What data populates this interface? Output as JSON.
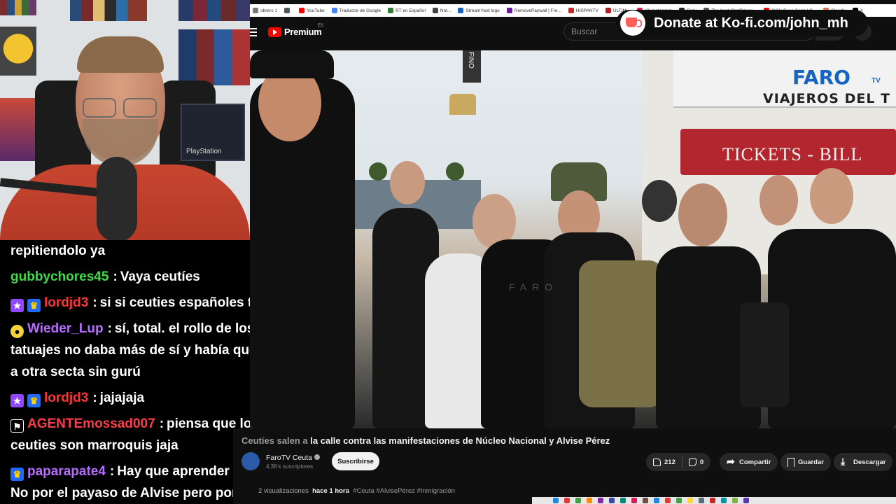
{
  "browser": {
    "bookmarks": [
      {
        "label": "obrero 1",
        "color": "#777777"
      },
      {
        "label": "",
        "color": "#555555"
      },
      {
        "label": "YouTube",
        "color": "#ff0000"
      },
      {
        "label": "Traductor de Google",
        "color": "#4285f4"
      },
      {
        "label": "RT en Español",
        "color": "#2e7d32"
      },
      {
        "label": "Not...",
        "color": "#444444"
      },
      {
        "label": "StreamYard logo",
        "color": "#1565c0"
      },
      {
        "label": "RemovePaywall | Fre...",
        "color": "#6a1b9a"
      },
      {
        "label": "HISPANTV",
        "color": "#c62828"
      },
      {
        "label": "ÚLTIM...",
        "color": "#b71c1c"
      },
      {
        "label": "(3) Instagram",
        "color": "#d81b60"
      },
      {
        "label": "Grok",
        "color": "#222222"
      },
      {
        "label": "The best ChatBot an...",
        "color": "#555555"
      },
      {
        "label": "(191) Paco Sanz / C...",
        "color": "#ff0000"
      },
      {
        "label": "Claude",
        "color": "#d97757"
      },
      {
        "label": "X",
        "color": "#000000"
      }
    ]
  },
  "youtube": {
    "logo_text": "Premium",
    "country_code": "ES",
    "search_placeholder": "Buscar",
    "video": {
      "title_dim": "Ceutíes salen a",
      "title": "la calle contra las manifestaciones de Núcleo Nacional y Alvise Pérez",
      "channel_name": "FaroTV Ceuta",
      "subscribers": "4,38 k suscriptores",
      "subscribe_label": "Suscribirse",
      "likes": "212",
      "dislikes": "0",
      "share_label": "Compartir",
      "save_label": "Guardar",
      "download_label": "Descargar",
      "views": "2 visualizaciones",
      "time_ago": "hace 1 hora",
      "tags": "#Ceuta #AlvisePérez #Inmigración"
    },
    "overlay_texts": {
      "faro_logo": "FARO",
      "faro_tv": "TV",
      "viajeros": "VIAJEROS DEL T",
      "tickets": "TICKETS - BILL",
      "fino": "FINO",
      "watermark": "FARO"
    }
  },
  "kofi": {
    "text": "Donate at Ko-fi.com/john_mh"
  },
  "webcam": {
    "console_label": "PlayStation"
  },
  "chat": {
    "messages": [
      {
        "badges": [],
        "user": "",
        "color": "#ffffff",
        "text": "repitiendolo ya"
      },
      {
        "badges": [],
        "user": "gubbychores45",
        "color": "#3ddc48",
        "text": "Vaya ceutíes"
      },
      {
        "badges": [
          "star",
          "crown"
        ],
        "user": "lordjd3",
        "color": "#ff3333",
        "text": "si si ceuties españoles todos"
      },
      {
        "badges": [
          "dots"
        ],
        "user": "Wieder_Lup",
        "color": "#b76cff",
        "text": "sí, total. el rollo de los tatuajes no daba más de sí y había que buscar a otra secta sin gurú"
      },
      {
        "badges": [
          "star",
          "crown"
        ],
        "user": "lordjd3",
        "color": "#ff3333",
        "text": "jajajaja"
      },
      {
        "badges": [
          "tag"
        ],
        "user": "AGENTEmossad007",
        "color": "#ff3b4a",
        "text": "piensa que los ceuties son marroquis jaja"
      },
      {
        "badges": [
          "crown"
        ],
        "user": "paparapate4",
        "color": "#b76cff",
        "text": "Hay que aprender la lección. No por el payaso de Alvise pero por NN"
      }
    ]
  }
}
